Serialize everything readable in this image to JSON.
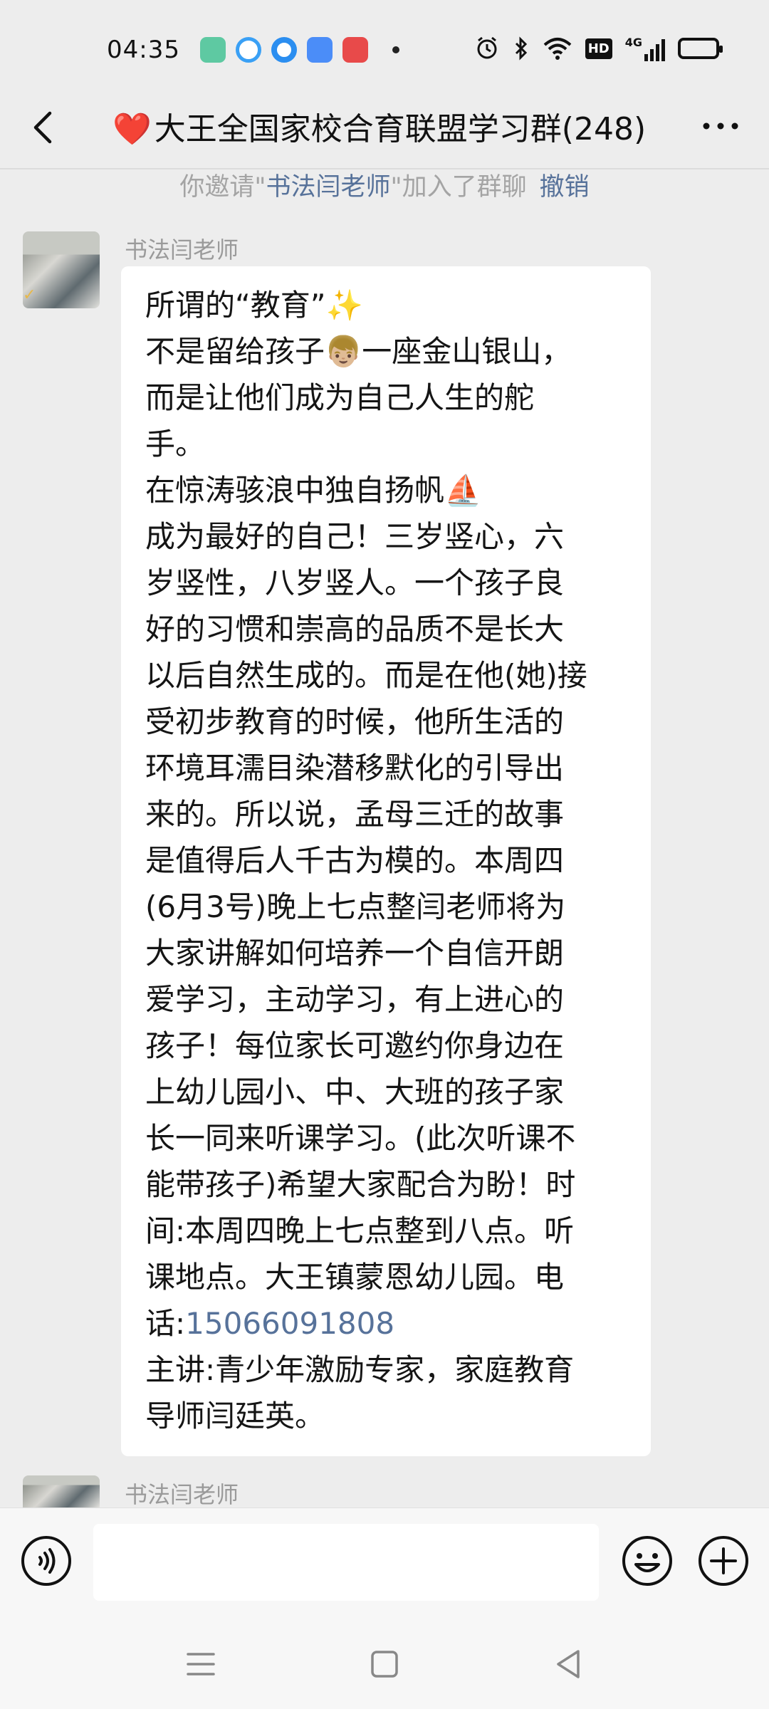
{
  "status_bar": {
    "time": "04:35",
    "app_icons": [
      {
        "name": "green-app-icon",
        "color": "#5ec9a2"
      },
      {
        "name": "browser-icon",
        "color": "#3aa0f5"
      },
      {
        "name": "target-app-icon",
        "color": "#2b8ef0"
      },
      {
        "name": "blue-app-icon",
        "color": "#4b8df8"
      },
      {
        "name": "red-app-icon",
        "color": "#e84a4a"
      }
    ],
    "right_icons": [
      "alarm-icon",
      "bluetooth-icon",
      "wifi-icon",
      "hd-icon",
      "signal-4g-icon",
      "battery-icon"
    ],
    "hd_label": "HD",
    "network_label": "4G"
  },
  "header": {
    "back_icon": "chevron-left-icon",
    "title_emoji": "❤️",
    "title": "大王全国家校合育联盟学习群(248)",
    "more_icon": "more-horizontal-icon"
  },
  "notice": {
    "prefix": "你邀请\"",
    "invitee": "书法闫老师",
    "suffix": "\"加入了群聊",
    "revoke_label": "撤销"
  },
  "messages": [
    {
      "sender": "书法闫老师",
      "lines": [
        "所谓的“教育”✨",
        "不是留给孩子👦🏼一座金山银山，\n而是让他们成为自己人生的舵\n手。",
        "在惊涛骇浪中独自扬帆⛵",
        "成为最好的自己！三岁竖心，六\n岁竖性，八岁竖人。一个孩子良\n好的习惯和崇高的品质不是长大\n以后自然生成的。而是在他(她)接\n受初步教育的时候，他所生活的\n环境耳濡目染潜移默化的引导出\n来的。所以说，孟母三迁的故事\n是值得后人千古为模的。本周四\n(6月3号)晚上七点整闫老师将为\n大家讲解如何培养一个自信开朗\n爱学习，主动学习，有上进心的\n孩子！每位家长可邀约你身边在\n上幼儿园小、中、大班的孩子家\n长一同来听课学习。(此次听课不\n能带孩子)希望大家配合为盼！时\n间:本周四晚上七点整到八点。听\n课地点。大王镇蒙恩幼儿园。电\n话:"
      ],
      "phone": "15066091808",
      "closing": "主讲:青少年激励专家，家庭教育\n导师闫廷英。"
    },
    {
      "sender": "书法闫老师"
    }
  ],
  "input_bar": {
    "voice_icon": "voice-icon",
    "placeholder": "",
    "emoji_icon": "emoji-icon",
    "plus_icon": "plus-icon"
  },
  "nav_bar": {
    "icons": [
      "menu-icon",
      "home-icon",
      "back-triangle-icon"
    ]
  },
  "colors": {
    "background": "#ededed",
    "bubble": "#ffffff",
    "link": "#57729a",
    "muted": "#a4a4a4"
  }
}
